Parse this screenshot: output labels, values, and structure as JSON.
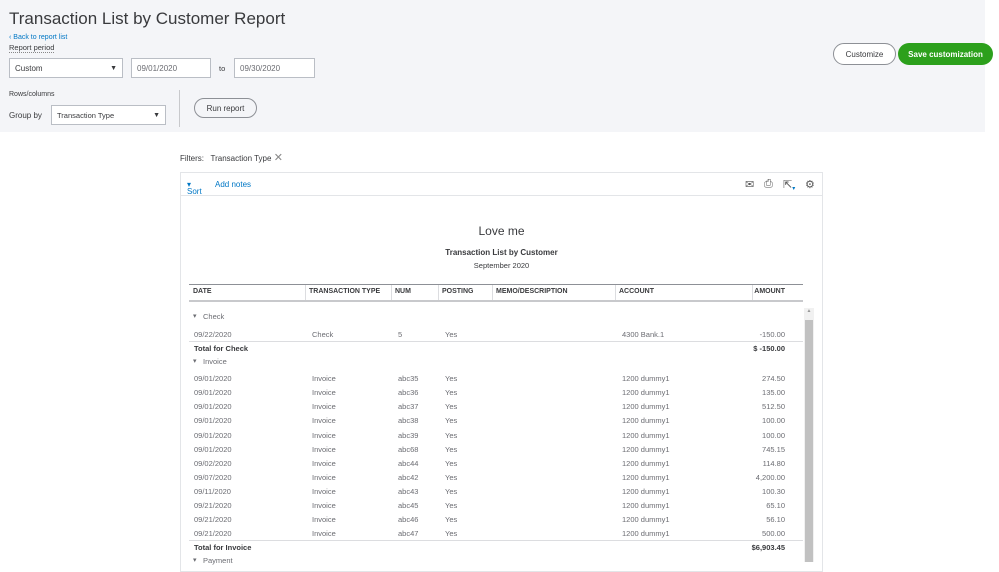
{
  "header": {
    "title": "Transaction List by Customer Report",
    "back_link": "Back to report list",
    "report_period_label": "Report period",
    "period": "Custom",
    "from": "09/01/2020",
    "to_label": "to",
    "to": "09/30/2020",
    "rows_columns_label": "Rows/columns",
    "group_by_label": "Group by",
    "group_by": "Transaction Type",
    "run_report": "Run report",
    "customize": "Customize",
    "save_customization": "Save customization"
  },
  "filters": {
    "label": "Filters:",
    "chip": "Transaction Type"
  },
  "toolbar": {
    "sort": "Sort",
    "add_notes": "Add notes"
  },
  "report": {
    "company": "Love me",
    "name": "Transaction List by Customer",
    "period": "September 2020",
    "columns": [
      "DATE",
      "TRANSACTION TYPE",
      "NUM",
      "POSTING",
      "MEMO/DESCRIPTION",
      "ACCOUNT",
      "AMOUNT"
    ],
    "groups": [
      {
        "name": "Check",
        "rows": [
          [
            "09/22/2020",
            "Check",
            "5",
            "Yes",
            "",
            "4300 Bank.1",
            "-150.00"
          ]
        ],
        "total_label": "Total for Check",
        "total": "$ -150.00"
      },
      {
        "name": "Invoice",
        "rows": [
          [
            "09/01/2020",
            "Invoice",
            "abc35",
            "Yes",
            "",
            "1200 dummy1",
            "274.50"
          ],
          [
            "09/01/2020",
            "Invoice",
            "abc36",
            "Yes",
            "",
            "1200 dummy1",
            "135.00"
          ],
          [
            "09/01/2020",
            "Invoice",
            "abc37",
            "Yes",
            "",
            "1200 dummy1",
            "512.50"
          ],
          [
            "09/01/2020",
            "Invoice",
            "abc38",
            "Yes",
            "",
            "1200 dummy1",
            "100.00"
          ],
          [
            "09/01/2020",
            "Invoice",
            "abc39",
            "Yes",
            "",
            "1200 dummy1",
            "100.00"
          ],
          [
            "09/01/2020",
            "Invoice",
            "abc68",
            "Yes",
            "",
            "1200 dummy1",
            "745.15"
          ],
          [
            "09/02/2020",
            "Invoice",
            "abc44",
            "Yes",
            "",
            "1200 dummy1",
            "114.80"
          ],
          [
            "09/07/2020",
            "Invoice",
            "abc42",
            "Yes",
            "",
            "1200 dummy1",
            "4,200.00"
          ],
          [
            "09/11/2020",
            "Invoice",
            "abc43",
            "Yes",
            "",
            "1200 dummy1",
            "100.30"
          ],
          [
            "09/21/2020",
            "Invoice",
            "abc45",
            "Yes",
            "",
            "1200 dummy1",
            "65.10"
          ],
          [
            "09/21/2020",
            "Invoice",
            "abc46",
            "Yes",
            "",
            "1200 dummy1",
            "56.10"
          ],
          [
            "09/21/2020",
            "Invoice",
            "abc47",
            "Yes",
            "",
            "1200 dummy1",
            "500.00"
          ]
        ],
        "total_label": "Total for Invoice",
        "total": "$6,903.45"
      },
      {
        "name": "Payment",
        "rows": []
      }
    ]
  }
}
